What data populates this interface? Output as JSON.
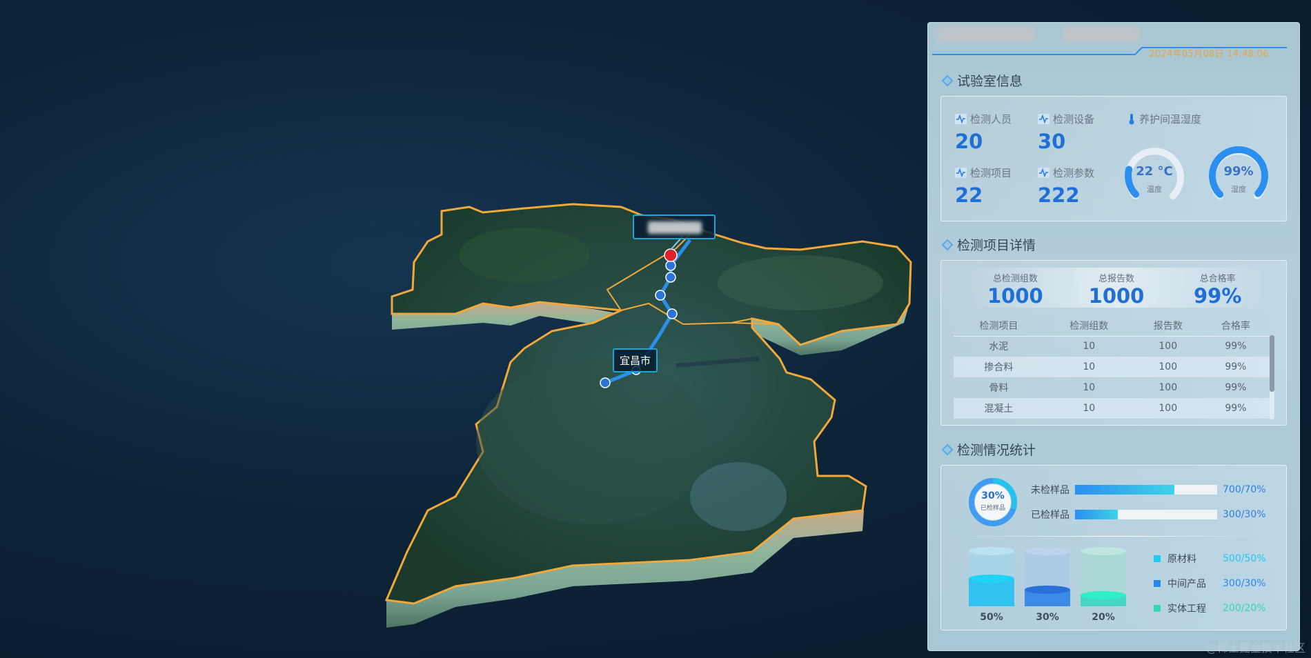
{
  "map": {
    "city_label": "宜昌市",
    "colors": {
      "outline": "#f2a93b",
      "route": "#2b90ea",
      "marker": "#e0202a"
    }
  },
  "header": {
    "datetime": "2024年05月08日 14:48:06"
  },
  "lab_info": {
    "title": "试验室信息",
    "stats": [
      {
        "label": "检测人员",
        "value": "20",
        "icon": "pulse-icon"
      },
      {
        "label": "检测设备",
        "value": "30",
        "icon": "pulse-icon"
      },
      {
        "label": "检测项目",
        "value": "22",
        "icon": "pulse-icon"
      },
      {
        "label": "检测参数",
        "value": "222",
        "icon": "pulse-icon"
      }
    ],
    "curing_room": {
      "label": "养护间温湿度",
      "icon": "thermometer-icon",
      "temperature": {
        "value": "22 °C",
        "caption": "温度",
        "level": 0.22
      },
      "humidity": {
        "value": "99%",
        "caption": "湿度",
        "level": 0.99
      }
    }
  },
  "items_detail": {
    "title": "检测项目详情",
    "summary": [
      {
        "label": "总检测组数",
        "value": "1000"
      },
      {
        "label": "总报告数",
        "value": "1000"
      },
      {
        "label": "总合格率",
        "value": "99%"
      }
    ],
    "columns": [
      "检测项目",
      "检测组数",
      "报告数",
      "合格率"
    ],
    "rows": [
      [
        "水泥",
        "10",
        "100",
        "99%"
      ],
      [
        "掺合料",
        "10",
        "100",
        "99%"
      ],
      [
        "骨料",
        "10",
        "100",
        "99%"
      ],
      [
        "混凝土",
        "10",
        "100",
        "99%"
      ]
    ]
  },
  "inspection_stats": {
    "title": "检测情况统计",
    "donut": {
      "value": "30%",
      "caption": "已检样品",
      "fraction": 0.3
    },
    "bars": [
      {
        "label": "未检样品",
        "value": "700/70%",
        "fraction": 0.7
      },
      {
        "label": "已检样品",
        "value": "300/30%",
        "fraction": 0.3
      }
    ],
    "cylinders": [
      {
        "pct": "50%",
        "fraction": 0.5
      },
      {
        "pct": "30%",
        "fraction": 0.3
      },
      {
        "pct": "20%",
        "fraction": 0.2
      }
    ],
    "legend": [
      {
        "label": "原材料",
        "value": "500/50%",
        "color": "#21c9ee"
      },
      {
        "label": "中间产品",
        "value": "300/30%",
        "color": "#2b86ea"
      },
      {
        "label": "实体工程",
        "value": "200/20%",
        "color": "#34d7b5"
      }
    ]
  },
  "watermark": "@稀土掘金技术社区"
}
